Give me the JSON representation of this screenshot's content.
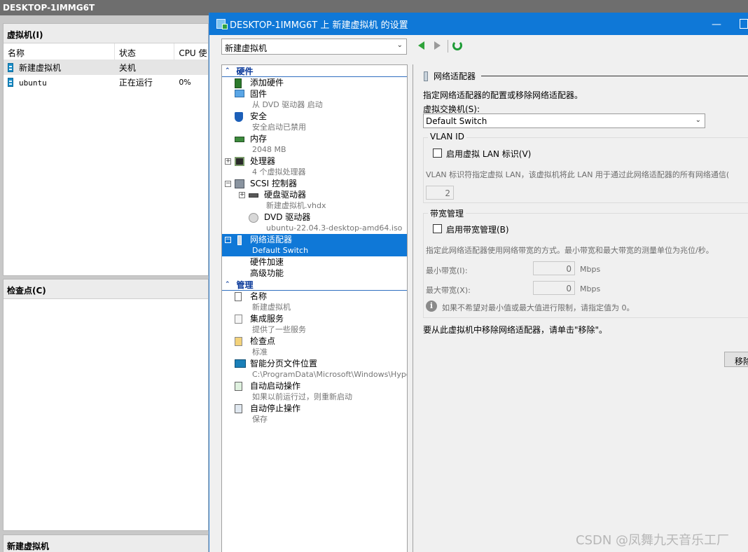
{
  "window_title": "DESKTOP-1IMMG6T",
  "manager": {
    "vm_pane_title": "虚拟机(I)",
    "columns": [
      "名称",
      "状态",
      "CPU 使"
    ],
    "vms": [
      {
        "name": "新建虚拟机",
        "state": "关机",
        "cpu": ""
      },
      {
        "name": "ubuntu",
        "state": "正在运行",
        "cpu": "0%"
      }
    ],
    "checkpoint_pane_title": "检查点(C)",
    "details_pane_title": "新建虚拟机"
  },
  "dialog": {
    "title": "DESKTOP-1IMMG6T 上 新建虚拟机 的设置",
    "vm_select_value": "新建虚拟机",
    "hardware_section": "硬件",
    "management_section": "管理",
    "hardware_items": [
      {
        "label": "添加硬件",
        "sub": ""
      },
      {
        "label": "固件",
        "sub": "从 DVD 驱动器 启动"
      },
      {
        "label": "安全",
        "sub": "安全启动已禁用"
      },
      {
        "label": "内存",
        "sub": "2048 MB"
      },
      {
        "label": "处理器",
        "sub": "4 个虚拟处理器"
      },
      {
        "label": "SCSI 控制器",
        "sub": ""
      },
      {
        "label": "硬盘驱动器",
        "sub": "新建虚拟机.vhdx"
      },
      {
        "label": "DVD 驱动器",
        "sub": "ubuntu-22.04.3-desktop-amd64.iso"
      },
      {
        "label": "网络适配器",
        "sub": "Default Switch"
      },
      {
        "label": "硬件加速",
        "sub": ""
      },
      {
        "label": "高级功能",
        "sub": ""
      }
    ],
    "management_items": [
      {
        "label": "名称",
        "sub": "新建虚拟机"
      },
      {
        "label": "集成服务",
        "sub": "提供了一些服务"
      },
      {
        "label": "检查点",
        "sub": "标准"
      },
      {
        "label": "智能分页文件位置",
        "sub": "C:\\ProgramData\\Microsoft\\Windows\\Hyper-V"
      },
      {
        "label": "自动启动操作",
        "sub": "如果以前运行过，则重新启动"
      },
      {
        "label": "自动停止操作",
        "sub": "保存"
      }
    ],
    "panel": {
      "heading": "网络适配器",
      "description": "指定网络适配器的配置或移除网络适配器。",
      "switch_label": "虚拟交换机(S):",
      "switch_value": "Default Switch",
      "vlan_group": "VLAN ID",
      "vlan_checkbox": "启用虚拟 LAN 标识(V)",
      "vlan_hint": "VLAN 标识符指定虚拟 LAN，该虚拟机将此 LAN 用于通过此网络适配器的所有网络通信(",
      "vlan_value": "2",
      "bw_group": "带宽管理",
      "bw_checkbox": "启用带宽管理(B)",
      "bw_hint": "指定此网络适配器使用网络带宽的方式。最小带宽和最大带宽的测量单位为兆位/秒。",
      "min_label": "最小带宽(I):",
      "min_value": "0",
      "max_label": "最大带宽(X):",
      "max_value": "0",
      "unit": "Mbps",
      "info_text": "如果不希望对最小值或最大值进行限制，请指定值为 0。",
      "remove_hint": "要从此虚拟机中移除网络适配器，请单击\"移除\"。",
      "remove_button": "移除"
    }
  },
  "watermark": "CSDN @凤舞九天音乐工厂",
  "colors": {
    "selection": "#0f78d7",
    "titlebar": "#0f78d7",
    "section": "#0b3a9a"
  }
}
